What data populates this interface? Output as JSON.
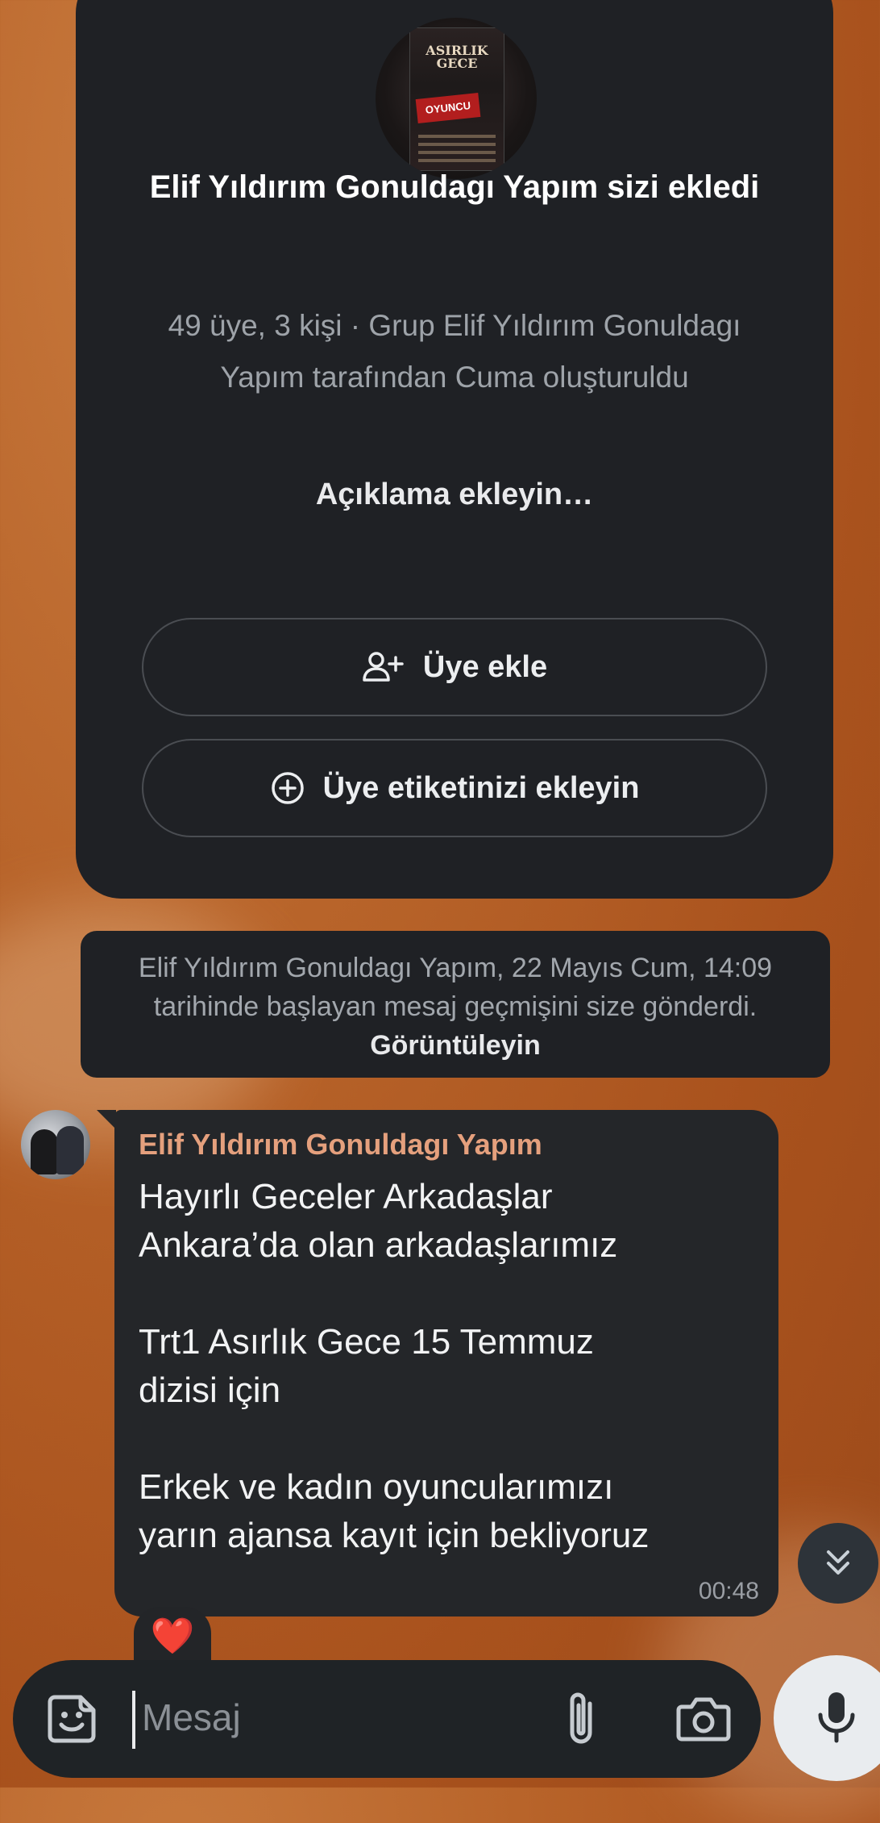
{
  "group": {
    "poster_title": "ASIRLIK GECE",
    "poster_badge": "OYUNCU",
    "title": "Elif Yıldırım Gonuldagı Yapım sizi ekledi",
    "meta": "49 üye, 3 kişi · Grup Elif Yıldırım Gonuldagı Yapım tarafından Cuma oluşturuldu",
    "description_prompt": "Açıklama ekleyin…",
    "add_member_label": "Üye ekle",
    "add_member_icon": "add-person-icon",
    "add_tag_label": "Üye etiketinizi ekleyin",
    "add_tag_icon": "plus-circle-icon"
  },
  "notice": {
    "text": "Elif Yıldırım Gonuldagı Yapım, 22 Mayıs Cum, 14:09 tarihinde başlayan mesaj geçmişini size gönderdi.",
    "link": "Görüntüleyin"
  },
  "message": {
    "sender": "Elif Yıldırım Gonuldagı Yapım",
    "text": "Hayırlı Geceler Arkadaşlar\nAnkara’da olan arkadaşlarımız\n\nTrt1 Asırlık Gece 15 Temmuz\ndizisi için\n\nErkek ve kadın oyuncularımızı\nyarın ajansa kayıt için bekliyoruz",
    "time": "00:48",
    "reaction": "❤️"
  },
  "composer": {
    "placeholder": "Mesaj",
    "sticker_icon": "sticker-icon",
    "attach_icon": "paperclip-icon",
    "camera_icon": "camera-icon",
    "mic_icon": "microphone-icon",
    "scroll_icon": "chevron-double-down-icon"
  },
  "colors": {
    "card_bg": "#1f2125",
    "sender_name": "#e5a07d",
    "wallpaper": "#b8642a"
  }
}
